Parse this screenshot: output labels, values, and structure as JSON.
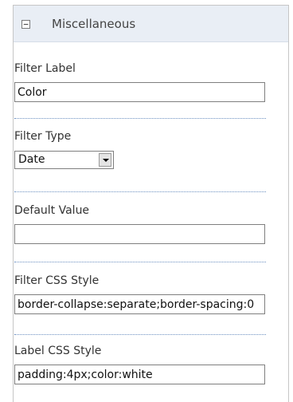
{
  "section": {
    "title": "Miscellaneous",
    "collapse_glyph": "−"
  },
  "fields": {
    "filter_label": {
      "label": "Filter Label",
      "value": "Color"
    },
    "filter_type": {
      "label": "Filter Type",
      "selected": "Date"
    },
    "default_value": {
      "label": "Default Value",
      "value": ""
    },
    "filter_css_style": {
      "label": "Filter CSS Style",
      "value": "border-collapse:separate;border-spacing:0"
    },
    "label_css_style": {
      "label": "Label CSS Style",
      "value": "padding:4px;color:white"
    }
  },
  "colors": {
    "header_bg": "#e9eef5",
    "divider": "#6b8fc0",
    "border": "#c6c6c6"
  },
  "icons": {
    "collapse": "minus-box-icon",
    "dropdown": "chevron-down-icon"
  }
}
